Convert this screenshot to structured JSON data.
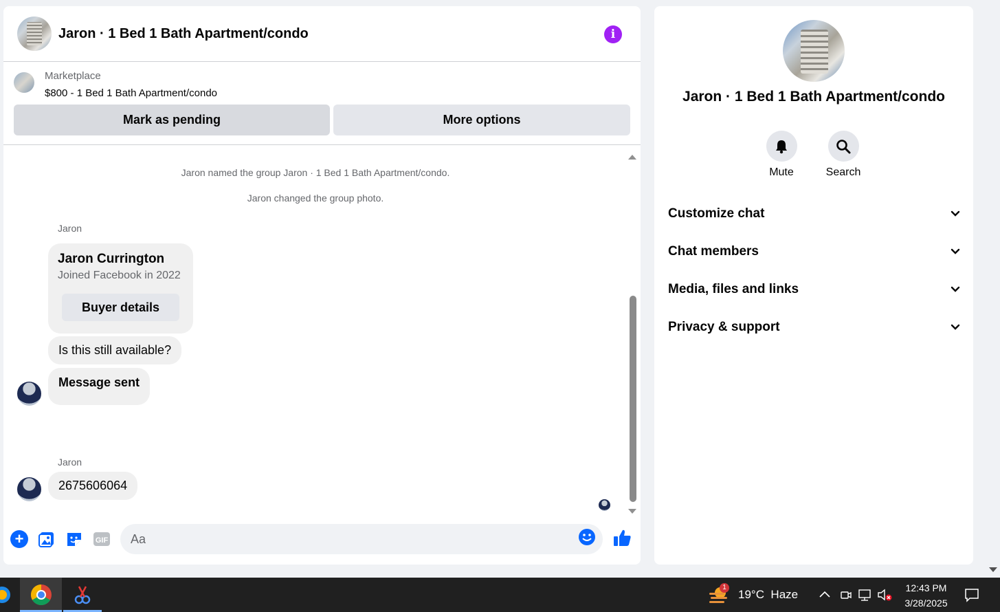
{
  "header": {
    "title": "Jaron · 1 Bed 1 Bath Apartment/condo"
  },
  "marketplace": {
    "label": "Marketplace",
    "listing": "$800 - 1 Bed 1 Bath Apartment/condo",
    "pending_button": "Mark as pending",
    "more_button": "More options"
  },
  "messages": {
    "system": [
      "Jaron named the group Jaron · 1 Bed 1 Bath Apartment/condo.",
      "Jaron changed the group photo."
    ],
    "sender1": "Jaron",
    "card": {
      "name": "Jaron Currington",
      "sub": "Joined Facebook in 2022",
      "button": "Buyer details"
    },
    "bubble1": "Is this still available?",
    "bubble2": "Message sent",
    "sender2": "Jaron",
    "bubble3": "2675606064"
  },
  "composer": {
    "placeholder": "Aa"
  },
  "details": {
    "title": "Jaron · 1 Bed 1 Bath Apartment/condo",
    "mute": "Mute",
    "search": "Search",
    "sections": [
      "Customize chat",
      "Chat members",
      "Media, files and links",
      "Privacy & support"
    ]
  },
  "taskbar": {
    "weather": "19°C  Haze",
    "weather_badge": "1",
    "time": "12:43 PM",
    "date": "3/28/2025"
  },
  "colors": {
    "accent": "#0866ff",
    "info": "#a021f4",
    "taskbar": "#202020"
  }
}
